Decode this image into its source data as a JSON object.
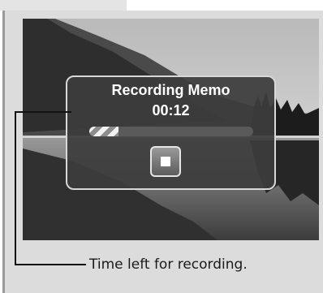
{
  "dialog": {
    "title": "Recording Memo",
    "time": "00:12",
    "progress": 0.18,
    "stop_icon": "stop-icon"
  },
  "callout": {
    "caption": "Time left for recording."
  },
  "colors": {
    "dialog_bg": "#3c3c3c",
    "dialog_border": "#d8d8d8",
    "frame_bg": "#dcdcdc"
  }
}
